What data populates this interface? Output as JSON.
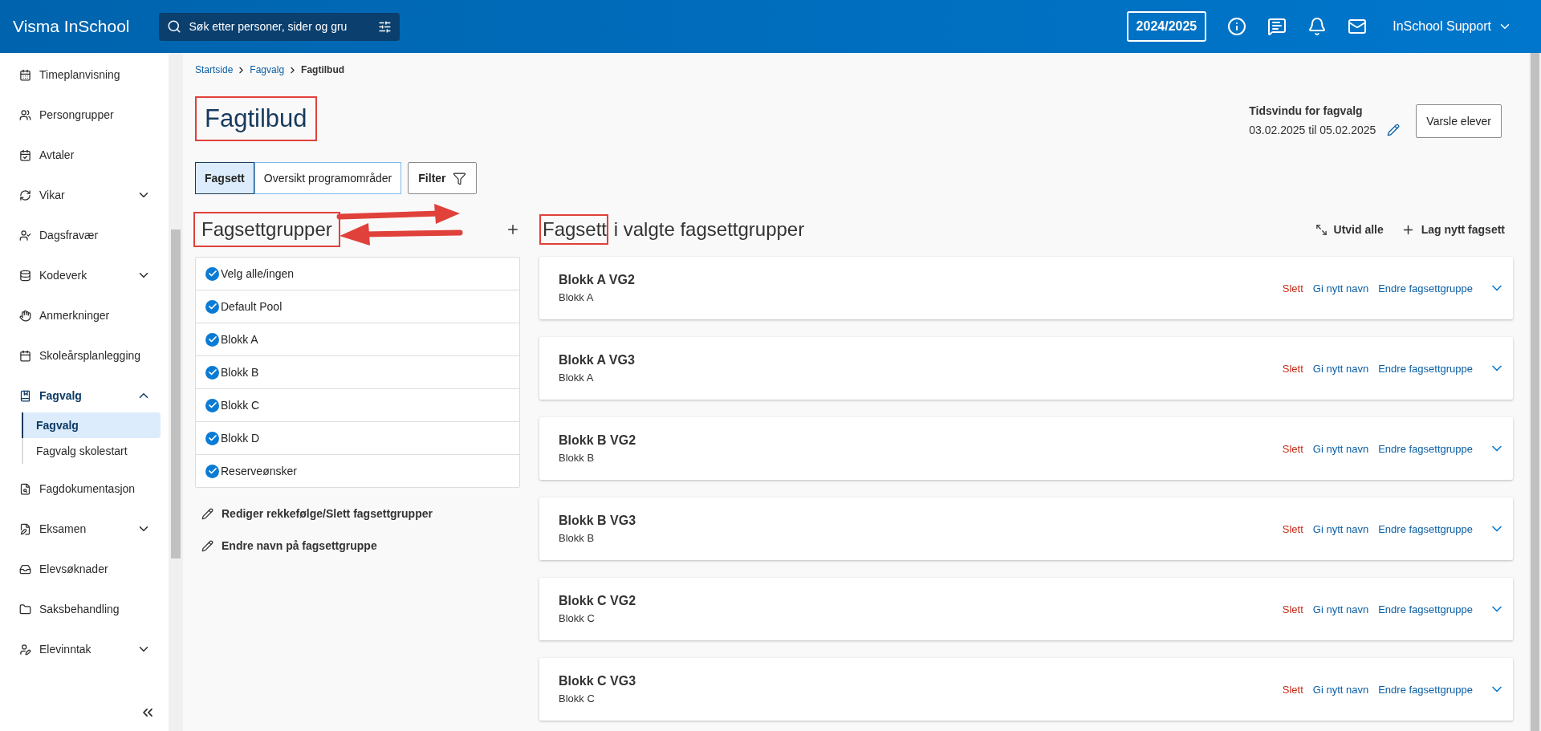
{
  "header": {
    "logo": "Visma InSchool",
    "search": {
      "placeholder": "Søk etter personer, sider og gru"
    },
    "year": "2024/2025",
    "user": "InSchool Support"
  },
  "sidebar": {
    "items": [
      {
        "label": "Timeplanvisning"
      },
      {
        "label": "Persongrupper"
      },
      {
        "label": "Avtaler"
      },
      {
        "label": "Vikar",
        "expanded": false
      },
      {
        "label": "Dagsfravær"
      },
      {
        "label": "Kodeverk",
        "expanded": false
      },
      {
        "label": "Anmerkninger"
      },
      {
        "label": "Skoleårsplanlegging"
      },
      {
        "label": "Fagvalg",
        "expanded": true,
        "children": [
          {
            "label": "Fagvalg",
            "selected": true
          },
          {
            "label": "Fagvalg skolestart",
            "selected": false
          }
        ]
      },
      {
        "label": "Fagdokumentasjon"
      },
      {
        "label": "Eksamen",
        "expanded": false
      },
      {
        "label": "Elevsøknader"
      },
      {
        "label": "Saksbehandling"
      },
      {
        "label": "Elevinntak",
        "expanded": false
      }
    ]
  },
  "breadcrumb": [
    "Startside",
    "Fagvalg",
    "Fagtilbud"
  ],
  "page_title": {
    "text": "Fagtilbud",
    "highlighted": true
  },
  "time_window": {
    "label": "Tidsvindu for fagvalg",
    "dates": "03.02.2025 til 05.02.2025"
  },
  "notify_button": "Varsle elever",
  "tabs": [
    {
      "label": "Fagsett",
      "selected": true
    },
    {
      "label": "Oversikt programområder",
      "selected": false
    }
  ],
  "filter_button": "Filter",
  "groups": {
    "title": "Fagsettgrupper",
    "highlighted": true,
    "items": [
      {
        "label": "Velg alle/ingen",
        "checked": true
      },
      {
        "label": "Default Pool",
        "checked": true
      },
      {
        "label": "Blokk A",
        "checked": true
      },
      {
        "label": "Blokk B",
        "checked": true
      },
      {
        "label": "Blokk C",
        "checked": true
      },
      {
        "label": "Blokk D",
        "checked": true
      },
      {
        "label": "Reserveønsker",
        "checked": true
      }
    ],
    "actions": [
      "Rediger rekkefølge/Slett fagsettgrupper",
      "Endre navn på fagsettgruppe"
    ]
  },
  "sets": {
    "title_highlighted": "Fagsett",
    "title_rest": "i valgte fagsettgrupper",
    "expand_all": "Utvid alle",
    "new_set": "Lag nytt fagsett",
    "cards": [
      {
        "title": "Blokk A VG2",
        "group": "Blokk A",
        "delete": "Slett",
        "rename": "Gi nytt navn",
        "change_group": "Endre fagsettgruppe",
        "expanded": false
      },
      {
        "title": "Blokk A VG3",
        "group": "Blokk A",
        "delete": "Slett",
        "rename": "Gi nytt navn",
        "change_group": "Endre fagsettgruppe",
        "expanded": false
      },
      {
        "title": "Blokk B VG2",
        "group": "Blokk B",
        "delete": "Slett",
        "rename": "Gi nytt navn",
        "change_group": "Endre fagsettgruppe",
        "expanded": false
      },
      {
        "title": "Blokk B VG3",
        "group": "Blokk B",
        "delete": "Slett",
        "rename": "Gi nytt navn",
        "change_group": "Endre fagsettgruppe",
        "expanded": false
      },
      {
        "title": "Blokk C VG2",
        "group": "Blokk C",
        "delete": "Slett",
        "rename": "Gi nytt navn",
        "change_group": "Endre fagsettgruppe",
        "expanded": false
      },
      {
        "title": "Blokk C VG3",
        "group": "Blokk C",
        "delete": "Slett",
        "rename": "Gi nytt navn",
        "change_group": "Endre fagsettgruppe",
        "expanded": false
      }
    ]
  }
}
